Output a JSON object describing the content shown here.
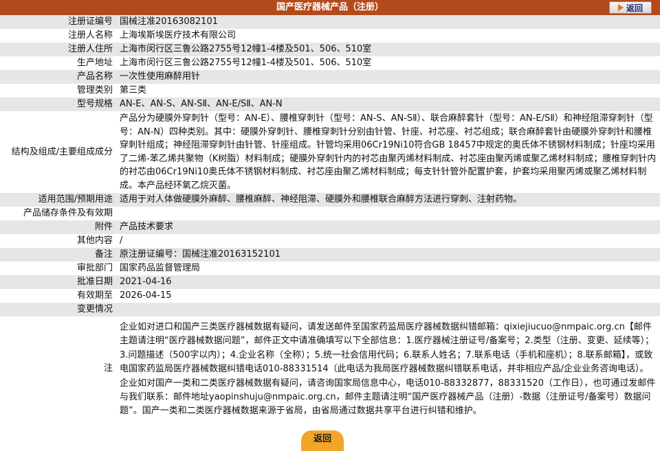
{
  "header": {
    "title": "国产医疗器械产品（注册）",
    "back_label": "返回"
  },
  "rows": [
    {
      "label": "注册证编号",
      "value": "国械注准20163082101"
    },
    {
      "label": "注册人名称",
      "value": "上海埃斯埃医疗技术有限公司"
    },
    {
      "label": "注册人住所",
      "value": "上海市闵行区三鲁公路2755号12幢1-4楼及501、506、510室"
    },
    {
      "label": "生产地址",
      "value": "上海市闵行区三鲁公路2755号12幢1-4楼及501、506、510室"
    },
    {
      "label": "产品名称",
      "value": "一次性使用麻醉用针"
    },
    {
      "label": "管理类别",
      "value": "第三类"
    },
    {
      "label": "型号规格",
      "value": "AN-E、AN-S、AN-SⅡ、AN-E/SⅡ、AN-N"
    },
    {
      "label": "结构及组成/主要组成成分",
      "value": "产品分为硬膜外穿刺针（型号：AN-E）、腰椎穿刺针（型号：AN-S、AN-SⅡ）、联合麻醉套针（型号：AN-E/SⅡ）和神经阻滞穿刺针（型号：AN-N）四种类别。其中：硬膜外穿刺针、腰椎穿刺针分别由针管、针座、衬芯座、衬芯组成；联合麻醉套针由硬膜外穿刺针和腰椎穿刺针组成；神经阻滞穿刺针由针管、针座组成。针管均采用06Cr19Ni10符合GB 18457中规定的奥氏体不锈钢材料制成；针座均采用了二烯-苯乙烯共聚物（K树脂）材料制成；硬膜外穿刺针内的衬芯由聚丙烯材料制成、衬芯座由聚丙烯或聚乙烯材料制成；腰椎穿刺针内的衬芯由06Cr19Ni10奥氏体不锈钢材料制成、衬芯座由聚乙烯材料制成；每支针针管外配置护套，护套均采用聚丙烯或聚乙烯材料制成。本产品经环氧乙烷灭菌。"
    },
    {
      "label": "适用范围/预期用途",
      "value": "适用于对人体做硬膜外麻醉、腰椎麻醉、神经阻滞、硬膜外和腰椎联合麻醉方法进行穿刺、注射药物。"
    },
    {
      "label": "产品储存条件及有效期",
      "value": ""
    },
    {
      "label": "附件",
      "value": "产品技术要求"
    },
    {
      "label": "其他内容",
      "value": "/"
    },
    {
      "label": "备注",
      "value": "原注册证编号：国械注准20163152101"
    },
    {
      "label": "审批部门",
      "value": "国家药品监督管理局"
    },
    {
      "label": "批准日期",
      "value": "2021-04-16"
    },
    {
      "label": "有效期至",
      "value": "2026-04-15"
    },
    {
      "label": "变更情况",
      "value": ""
    }
  ],
  "note": {
    "label": "注",
    "text": "企业如对进口和国产三类医疗器械数据有疑问，请发送邮件至国家药监局医疗器械数据纠错邮箱：qixiejiucuo@nmpaic.org.cn【邮件主题请注明“医疗器械数据问题”，邮件正文中请准确填写以下全部信息：1.医疗器械注册证号/备案号；2.类型（注册、变更、延续等）；3.问题描述（500字以内）；4.企业名称（全称）；5.统一社会信用代码；6.联系人姓名；7.联系电话（手机和座机）；8.联系邮箱】，或致电国家药监局医疗器械数据纠错电话010-88331514（此电话为我局医疗器械数据纠错联系电话，并非相应产品/企业业务咨询电话）。企业如对国产一类和二类医疗器械数据有疑问，请咨询国家局信息中心，电话010-88332877，88331520（工作日），也可通过发邮件与我们联系：邮件地址yaopinshuju@nmpaic.org.cn，邮件主题请注明“国产医疗器械产品（注册）-数据（注册证号/备案号）数据问题”。国产一类和二类医疗器械数据来源于省局，由省局通过数据共享平台进行纠错和维护。"
  },
  "footer": {
    "back_label": "返回"
  }
}
